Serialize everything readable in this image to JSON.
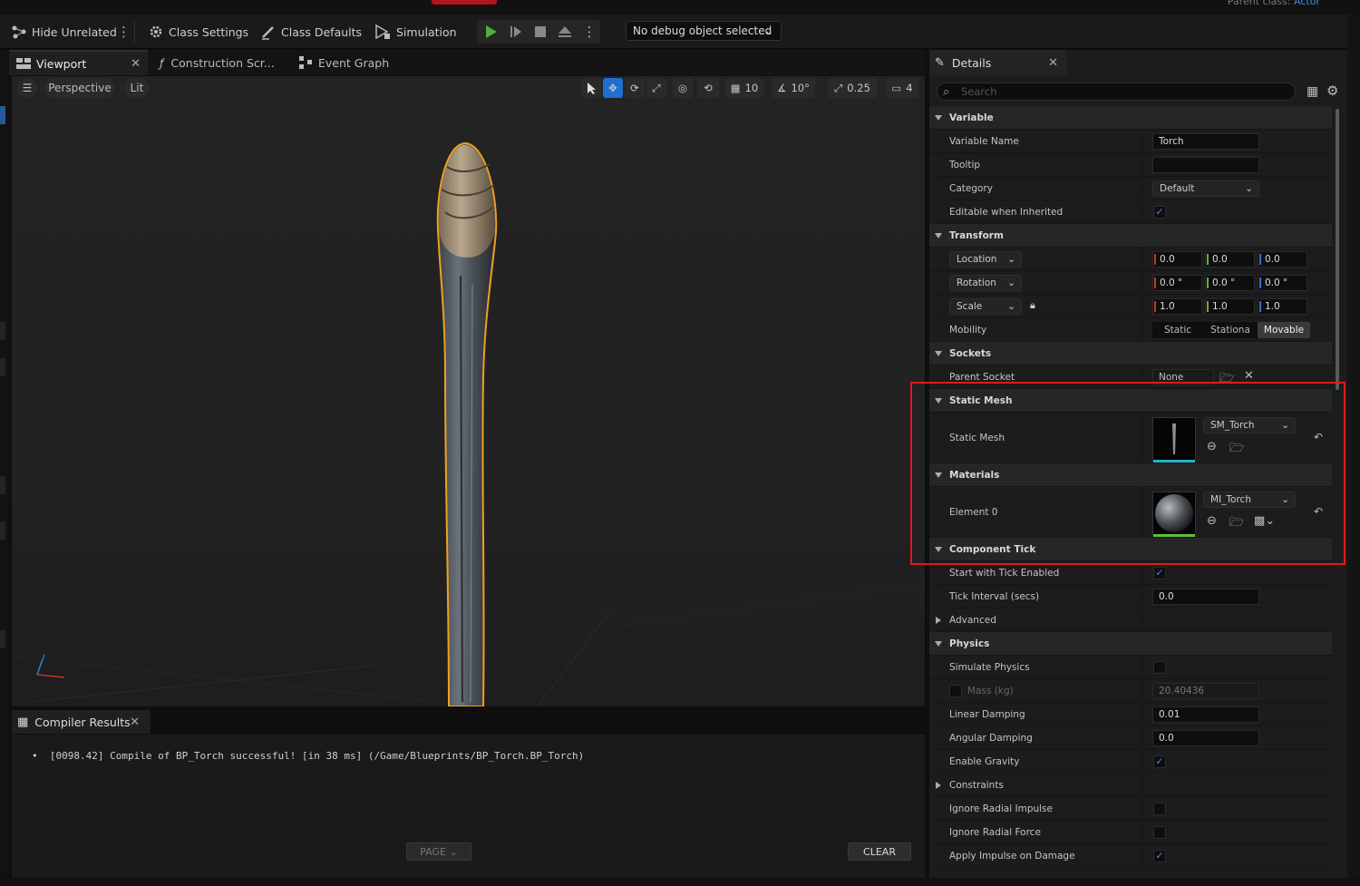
{
  "window": {
    "parent_class_label": "Parent class:",
    "parent_class_value": "Actor"
  },
  "toolbar": {
    "hide_unrelated": "Hide Unrelated",
    "class_settings": "Class Settings",
    "class_defaults": "Class Defaults",
    "simulation": "Simulation",
    "debug_select": "No debug object selected"
  },
  "tabs": {
    "viewport": "Viewport",
    "construction": "Construction Scr...",
    "event_graph": "Event Graph",
    "details": "Details",
    "compiler": "Compiler Results"
  },
  "viewport": {
    "perspective": "Perspective",
    "lit": "Lit",
    "grid_snap": "10",
    "rotation_snap": "10°",
    "scale_snap": "0.25",
    "camera_speed": "4"
  },
  "compiler": {
    "message": "[0098.42] Compile of BP_Torch successful! [in 38 ms] (/Game/Blueprints/BP_Torch.BP_Torch)",
    "page_label": "PAGE",
    "clear_label": "CLEAR"
  },
  "details": {
    "search_placeholder": "Search",
    "variable": {
      "title": "Variable",
      "name_label": "Variable Name",
      "name_value": "Torch",
      "tooltip_label": "Tooltip",
      "tooltip_value": "",
      "category_label": "Category",
      "category_value": "Default",
      "editable_label": "Editable when Inherited",
      "editable_checked": true
    },
    "transform": {
      "title": "Transform",
      "location_label": "Location",
      "location": [
        "0.0",
        "0.0",
        "0.0"
      ],
      "rotation_label": "Rotation",
      "rotation": [
        "0.0 °",
        "0.0 °",
        "0.0 °"
      ],
      "scale_label": "Scale",
      "scale": [
        "1.0",
        "1.0",
        "1.0"
      ],
      "mobility_label": "Mobility",
      "mobility_options": [
        "Static",
        "Stationa",
        "Movable"
      ],
      "mobility_selected": "Movable"
    },
    "sockets": {
      "title": "Sockets",
      "parent_socket_label": "Parent Socket",
      "parent_socket_value": "None"
    },
    "static_mesh": {
      "title": "Static Mesh",
      "mesh_label": "Static Mesh",
      "mesh_value": "SM_Torch"
    },
    "materials": {
      "title": "Materials",
      "element_label": "Element 0",
      "element_value": "MI_Torch"
    },
    "component_tick": {
      "title": "Component Tick",
      "start_label": "Start with Tick Enabled",
      "start_checked": true,
      "interval_label": "Tick Interval (secs)",
      "interval_value": "0.0"
    },
    "advanced": {
      "title": "Advanced"
    },
    "physics": {
      "title": "Physics",
      "simulate_label": "Simulate Physics",
      "simulate_checked": false,
      "mass_label": "Mass (kg)",
      "mass_value": "20.40436",
      "linear_label": "Linear Damping",
      "linear_value": "0.01",
      "angular_label": "Angular Damping",
      "angular_value": "0.0",
      "gravity_label": "Enable Gravity",
      "gravity_checked": true
    },
    "constraints": {
      "title": "Constraints"
    },
    "misc": {
      "radial_impulse_label": "Ignore Radial Impulse",
      "radial_force_label": "Ignore Radial Force",
      "apply_impulse_label": "Apply Impulse on Damage"
    }
  },
  "colors": {
    "accent": "#1f6fd0",
    "highlight_box": "#e0191f",
    "selection_outline": "#f0a020"
  }
}
